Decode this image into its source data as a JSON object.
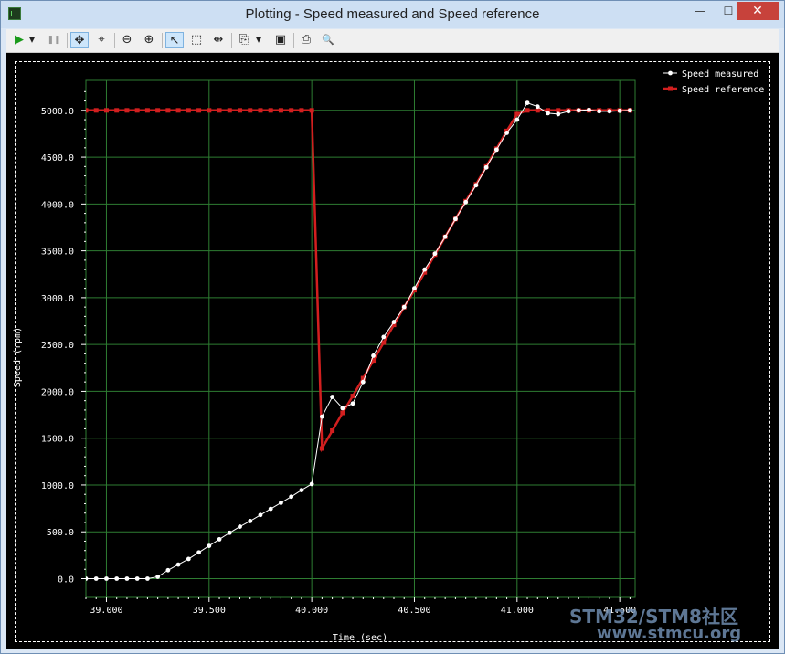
{
  "window": {
    "title": "Plotting  - Speed measured and Speed reference",
    "minimize_glyph": "—",
    "maximize_glyph": "☐",
    "close_glyph": "✕"
  },
  "toolbar": {
    "items": [
      {
        "name": "play-icon",
        "glyph": "▶",
        "color": "#1a9a1a"
      },
      {
        "name": "dropdown-arrow-icon",
        "glyph": "▾"
      },
      {
        "name": "pause-icon",
        "glyph": "❚❚",
        "color": "#9a9a9a"
      },
      {
        "name": "pan-icon",
        "glyph": "✥"
      },
      {
        "name": "zoom-fit-icon",
        "glyph": "⌖"
      },
      {
        "name": "zoom-out-icon",
        "glyph": "⊖"
      },
      {
        "name": "zoom-in-icon",
        "glyph": "⊕"
      },
      {
        "name": "select-pointer-icon",
        "glyph": "↖"
      },
      {
        "name": "select-rectangle-icon",
        "glyph": "⬚"
      },
      {
        "name": "cursor-marker-icon",
        "glyph": "⇹"
      },
      {
        "name": "copy-icon",
        "glyph": "⎘"
      },
      {
        "name": "dropdown-arrow-icon",
        "glyph": "▾"
      },
      {
        "name": "save-icon",
        "glyph": "▣"
      },
      {
        "name": "print-icon",
        "glyph": "⎙"
      },
      {
        "name": "print-preview-icon",
        "glyph": "🔍"
      }
    ]
  },
  "watermark": {
    "line1": "STM32/STM8社区",
    "line2": "www.stmcu.org"
  },
  "colors": {
    "background": "#000000",
    "grid": "#2e7d32",
    "measured": "#ffffff",
    "reference": "#d21f1f"
  },
  "chart_data": {
    "type": "line",
    "xlabel": "Time (sec)",
    "ylabel": "Speed (rpm)",
    "xlim": [
      38.9,
      41.575
    ],
    "ylim": [
      -200,
      5320
    ],
    "x_ticks": [
      39.0,
      39.5,
      40.0,
      40.5,
      41.0,
      41.5
    ],
    "x_tick_labels": [
      "39.000",
      "39.500",
      "40.000",
      "40.500",
      "41.000",
      "41.500"
    ],
    "y_ticks": [
      0,
      500,
      1000,
      1500,
      2000,
      2500,
      3000,
      3500,
      4000,
      4500,
      5000
    ],
    "y_tick_labels": [
      "0.0",
      "500.0",
      "1000.0",
      "1500.0",
      "2000.0",
      "2500.0",
      "3000.0",
      "3500.0",
      "4000.0",
      "4500.0",
      "5000.0"
    ],
    "grid": true,
    "legend_position": "top-right, outside plot",
    "series": [
      {
        "name": "Speed measured",
        "color": "#ffffff",
        "marker": "circle",
        "points": [
          [
            38.9,
            0
          ],
          [
            38.95,
            0
          ],
          [
            39.0,
            0
          ],
          [
            39.05,
            0
          ],
          [
            39.1,
            0
          ],
          [
            39.15,
            0
          ],
          [
            39.2,
            0
          ],
          [
            39.25,
            20
          ],
          [
            39.3,
            90
          ],
          [
            39.35,
            150
          ],
          [
            39.4,
            210
          ],
          [
            39.45,
            280
          ],
          [
            39.5,
            350
          ],
          [
            39.55,
            420
          ],
          [
            39.6,
            490
          ],
          [
            39.65,
            555
          ],
          [
            39.7,
            615
          ],
          [
            39.75,
            680
          ],
          [
            39.8,
            745
          ],
          [
            39.85,
            810
          ],
          [
            39.9,
            875
          ],
          [
            39.95,
            945
          ],
          [
            40.0,
            1010
          ],
          [
            40.05,
            1730
          ],
          [
            40.1,
            1940
          ],
          [
            40.15,
            1820
          ],
          [
            40.2,
            1870
          ],
          [
            40.25,
            2100
          ],
          [
            40.3,
            2380
          ],
          [
            40.35,
            2580
          ],
          [
            40.4,
            2740
          ],
          [
            40.45,
            2900
          ],
          [
            40.5,
            3100
          ],
          [
            40.55,
            3300
          ],
          [
            40.6,
            3470
          ],
          [
            40.65,
            3650
          ],
          [
            40.7,
            3840
          ],
          [
            40.75,
            4020
          ],
          [
            40.8,
            4200
          ],
          [
            40.85,
            4390
          ],
          [
            40.9,
            4580
          ],
          [
            40.95,
            4760
          ],
          [
            41.0,
            4900
          ],
          [
            41.05,
            5080
          ],
          [
            41.1,
            5040
          ],
          [
            41.15,
            4970
          ],
          [
            41.2,
            4960
          ],
          [
            41.25,
            4990
          ],
          [
            41.3,
            5000
          ],
          [
            41.35,
            5005
          ],
          [
            41.4,
            4990
          ],
          [
            41.45,
            4990
          ],
          [
            41.5,
            4995
          ],
          [
            41.55,
            5000
          ]
        ]
      },
      {
        "name": "Speed reference",
        "color": "#d21f1f",
        "marker": "square",
        "points": [
          [
            38.9,
            5000
          ],
          [
            38.95,
            5000
          ],
          [
            39.0,
            5000
          ],
          [
            39.05,
            5000
          ],
          [
            39.1,
            5000
          ],
          [
            39.15,
            5000
          ],
          [
            39.2,
            5000
          ],
          [
            39.25,
            5000
          ],
          [
            39.3,
            5000
          ],
          [
            39.35,
            5000
          ],
          [
            39.4,
            5000
          ],
          [
            39.45,
            5000
          ],
          [
            39.5,
            5000
          ],
          [
            39.55,
            5000
          ],
          [
            39.6,
            5000
          ],
          [
            39.65,
            5000
          ],
          [
            39.7,
            5000
          ],
          [
            39.75,
            5000
          ],
          [
            39.8,
            5000
          ],
          [
            39.85,
            5000
          ],
          [
            39.9,
            5000
          ],
          [
            39.95,
            5000
          ],
          [
            40.0,
            5000
          ],
          [
            40.05,
            1390
          ],
          [
            40.1,
            1580
          ],
          [
            40.15,
            1770
          ],
          [
            40.2,
            1950
          ],
          [
            40.25,
            2140
          ],
          [
            40.3,
            2330
          ],
          [
            40.35,
            2520
          ],
          [
            40.4,
            2710
          ],
          [
            40.45,
            2900
          ],
          [
            40.5,
            3080
          ],
          [
            40.55,
            3270
          ],
          [
            40.6,
            3460
          ],
          [
            40.65,
            3650
          ],
          [
            40.7,
            3840
          ],
          [
            40.75,
            4030
          ],
          [
            40.8,
            4210
          ],
          [
            40.85,
            4400
          ],
          [
            40.9,
            4590
          ],
          [
            40.95,
            4780
          ],
          [
            41.0,
            4960
          ],
          [
            41.05,
            5000
          ],
          [
            41.1,
            5000
          ],
          [
            41.15,
            5000
          ],
          [
            41.2,
            5000
          ],
          [
            41.25,
            5000
          ],
          [
            41.3,
            5000
          ],
          [
            41.35,
            5000
          ],
          [
            41.4,
            5000
          ],
          [
            41.45,
            5000
          ],
          [
            41.5,
            5000
          ],
          [
            41.55,
            5000
          ]
        ]
      }
    ]
  }
}
